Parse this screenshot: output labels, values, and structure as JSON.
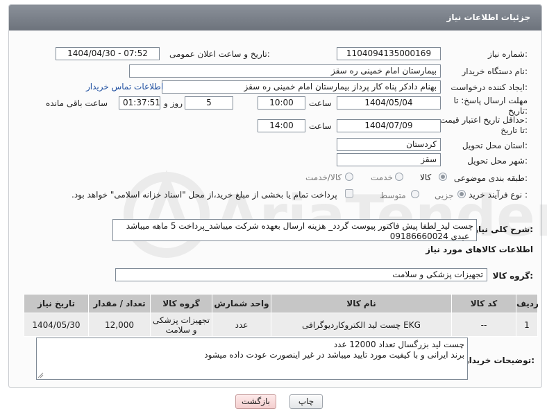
{
  "header": {
    "title": "جزئیات اطلاعات نیاز"
  },
  "fields": {
    "need_number_label": "شماره نیاز:",
    "need_number": "1104094135000169",
    "announce_label": "تاریخ و ساعت اعلان عمومی:",
    "announce_value": "1404/04/30 - 07:52",
    "buyer_org_label": "نام دستگاه خریدار:",
    "buyer_org": "بیمارستان امام خمینی  ره  سقز",
    "requester_label": "ایجاد کننده درخواست:",
    "requester": "بهنام دادکر پناه کار پرداز بیمارستان امام خمینی  ره  سقز",
    "contact_link": "اطلاعات تماس خریدار",
    "deadline_label_1": "مهلت ارسال پاسخ: تا",
    "deadline_label_2": "تاریخ:",
    "deadline_date": "1404/05/04",
    "time_label": "ساعت",
    "deadline_time": "10:00",
    "days_value": "5",
    "days_label": "روز و",
    "remaining_time": "01:37:51",
    "remaining_label": "ساعت باقی مانده",
    "validity_label_1": "حداقل تاریخ اعتبار قیمت:",
    "validity_label_2": "تا تاریخ:",
    "validity_date": "1404/07/09",
    "validity_time": "14:00",
    "province_label": "استان محل تحویل:",
    "province": "کردستان",
    "city_label": "شهر محل تحویل:",
    "city": "سقز",
    "category_label": "طبقه بندی موضوعی:",
    "category_options": [
      "کالا",
      "خدمت",
      "کالا/خدمت"
    ],
    "category_selected": "کالا",
    "process_label": "نوع فرآیند خرید :",
    "process_options": [
      "جزیی",
      "متوسط"
    ],
    "process_selected": "جزیی",
    "payment_note": "پرداخت تمام یا بخشی از مبلغ خرید،از محل \"اسناد خزانه اسلامی\" خواهد بود."
  },
  "description": {
    "label": "شرح کلی نیاز:",
    "text": "چست لید_لطفا پیش فاکتور پیوست گردد_ هزینه ارسال بعهده شرکت میباشد_پرداخت 5 ماهه میباشد _عبدی 09186660024"
  },
  "goods": {
    "section_title": "اطلاعات کالاهای مورد نیاز",
    "group_label": "گروه کالا:",
    "group_value": "تجهیزات پزشکی و سلامت",
    "columns": [
      "ردیف",
      "کد کالا",
      "نام کالا",
      "واحد شمارش",
      "گروه کالا",
      "تعداد / مقدار",
      "تاریخ نیاز"
    ],
    "rows": [
      [
        "1",
        "--",
        "چست لید الکتروکاردیوگرافی EKG",
        "عدد",
        "تجهیزات پزشکی و سلامت",
        "12,000",
        "1404/05/30"
      ]
    ]
  },
  "buyer_notes": {
    "label": "توضیحات خریدار:",
    "line1": "چست لید بزرگسال تعداد 12000 عدد",
    "line2": "برند ایرانی و با کیفیت مورد تایید میباشد در غیر اینصورت عودت داده میشود"
  },
  "buttons": {
    "print": "چاپ",
    "back": "بازگشت"
  },
  "watermark": {
    "text": "AriaTender.neT"
  },
  "colors": {
    "header": "#777d86",
    "link": "#1f4fa0",
    "table_header": "#c6c6c6",
    "back_button": "#f4cfcf"
  }
}
